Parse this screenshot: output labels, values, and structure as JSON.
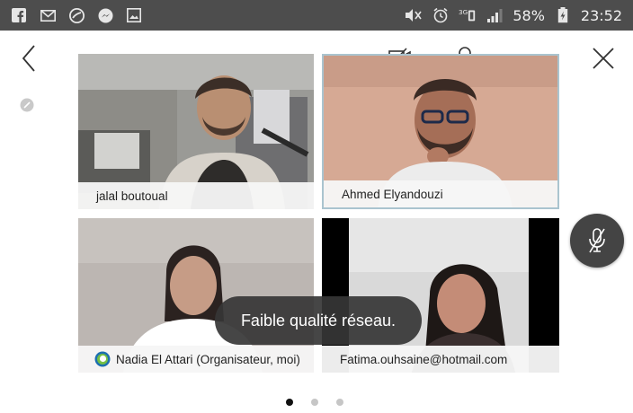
{
  "status_bar": {
    "battery": "58%",
    "time": "23:52",
    "network": "3G",
    "left_icons": [
      "facebook-icon",
      "mail-icon",
      "app-icon",
      "messenger-icon",
      "image-icon"
    ],
    "right_icons": [
      "mute-icon",
      "alarm-icon",
      "network-icon",
      "signal-icon",
      "battery-icon"
    ]
  },
  "toolbar": {
    "icons": [
      "back-icon",
      "camera-off-icon",
      "participants-icon",
      "more-icon",
      "close-icon"
    ],
    "more_label": "···"
  },
  "participants": [
    {
      "name": "jalal boutoual",
      "selected": false
    },
    {
      "name": "Ahmed Elyandouzi",
      "selected": true
    },
    {
      "name": "Nadia El Attari (Organisateur, moi)",
      "selected": false,
      "organizer_badge": true
    },
    {
      "name": "Fatima.ouhsaine@hotmail.com",
      "selected": false
    }
  ],
  "toast": {
    "message": "Faible qualité réseau."
  },
  "mute_button": {
    "icon": "mic-muted-icon"
  },
  "pager": {
    "pages": 3,
    "current": 1
  },
  "colors": {
    "status_bar": "#4d4d4d",
    "toast_bg": "#363636",
    "mute_btn": "#444444",
    "selected_border": "#aac4cf"
  }
}
